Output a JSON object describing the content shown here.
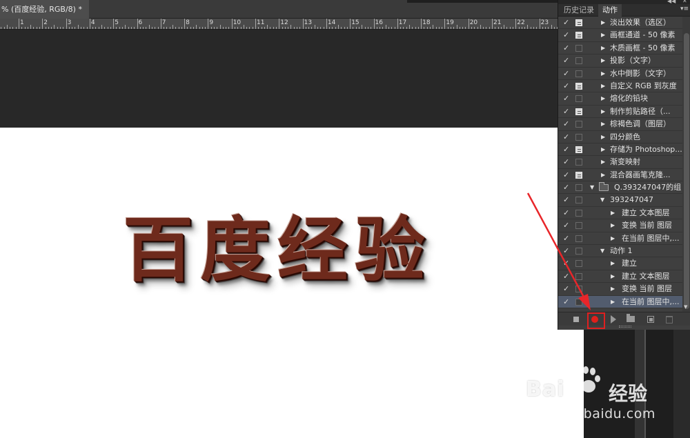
{
  "document": {
    "tab_title": "% (百度经验, RGB/8) *",
    "ruler_numbers": [
      "1",
      "2",
      "3",
      "4",
      "5",
      "6",
      "7",
      "8",
      "9",
      "10",
      "11",
      "12",
      "13",
      "14",
      "15",
      "16",
      "17",
      "18",
      "19",
      "20",
      "21",
      "22",
      "23"
    ],
    "canvas_text": "百度经验"
  },
  "panel": {
    "tabs": [
      {
        "label": "历史记录",
        "active": false
      },
      {
        "label": "动作",
        "active": true
      }
    ],
    "collapse_glyph": "◀◀",
    "close_glyph": "✕",
    "menu_glyph": "▾≡",
    "rows": [
      {
        "label": "淡出效果（选区）",
        "check": true,
        "dialog": true,
        "toggle": "▶",
        "level": "lvl0"
      },
      {
        "label": "画框通道 - 50 像素",
        "check": true,
        "dialog": true,
        "toggle": "▶",
        "level": "lvl0"
      },
      {
        "label": "木质画框 - 50 像素",
        "check": true,
        "dialog": false,
        "toggle": "▶",
        "level": "lvl0"
      },
      {
        "label": "投影（文字）",
        "check": true,
        "dialog": false,
        "toggle": "▶",
        "level": "lvl0"
      },
      {
        "label": "水中倒影（文字）",
        "check": true,
        "dialog": false,
        "toggle": "▶",
        "level": "lvl0"
      },
      {
        "label": "自定义 RGB 到灰度",
        "check": true,
        "dialog": true,
        "toggle": "▶",
        "level": "lvl0"
      },
      {
        "label": "熔化的铅块",
        "check": true,
        "dialog": false,
        "toggle": "▶",
        "level": "lvl0"
      },
      {
        "label": "制作剪贴路径（...",
        "check": true,
        "dialog": true,
        "toggle": "▶",
        "level": "lvl0"
      },
      {
        "label": "棕褐色调（图层）",
        "check": true,
        "dialog": false,
        "toggle": "▶",
        "level": "lvl0"
      },
      {
        "label": "四分颜色",
        "check": true,
        "dialog": false,
        "toggle": "▶",
        "level": "lvl0"
      },
      {
        "label": "存储为 Photoshop...",
        "check": true,
        "dialog": true,
        "toggle": "▶",
        "level": "lvl0"
      },
      {
        "label": "渐变映射",
        "check": true,
        "dialog": false,
        "toggle": "▶",
        "level": "lvl0"
      },
      {
        "label": "混合器画笔克隆...",
        "check": true,
        "dialog": true,
        "toggle": "▶",
        "level": "lvl0"
      },
      {
        "label": "Q.393247047的组",
        "check": true,
        "dialog": false,
        "toggle": "▼",
        "level": "set",
        "folder": true
      },
      {
        "label": "393247047",
        "check": true,
        "dialog": false,
        "toggle": "▼",
        "level": "lvl1"
      },
      {
        "label": "建立 文本图层",
        "check": true,
        "dialog": false,
        "toggle": "▶",
        "level": "lvl2"
      },
      {
        "label": "变换 当前 图层",
        "check": true,
        "dialog": false,
        "toggle": "▶",
        "level": "lvl2"
      },
      {
        "label": "在当前 图层中,...",
        "check": true,
        "dialog": false,
        "toggle": "▶",
        "level": "lvl2"
      },
      {
        "label": "动作 1",
        "check": true,
        "dialog": false,
        "toggle": "▼",
        "level": "lvl1"
      },
      {
        "label": "建立",
        "check": true,
        "dialog": false,
        "toggle": "▶",
        "level": "lvl2"
      },
      {
        "label": "建立 文本图层",
        "check": true,
        "dialog": false,
        "toggle": "▶",
        "level": "lvl2"
      },
      {
        "label": "变换 当前 图层",
        "check": true,
        "dialog": false,
        "toggle": "▶",
        "level": "lvl2"
      },
      {
        "label": "在当前 图层中,...",
        "check": true,
        "dialog": false,
        "toggle": "▶",
        "level": "lvl2",
        "selected": true
      }
    ],
    "bottom_buttons": [
      "stop",
      "record",
      "play",
      "new-set",
      "new-action",
      "delete"
    ],
    "record_color": "#e0201b",
    "highlight_color": "#e02020"
  },
  "watermark": {
    "logo": "Bai",
    "logo_suffix": "经验",
    "url": "jingyan.baidu.com"
  }
}
